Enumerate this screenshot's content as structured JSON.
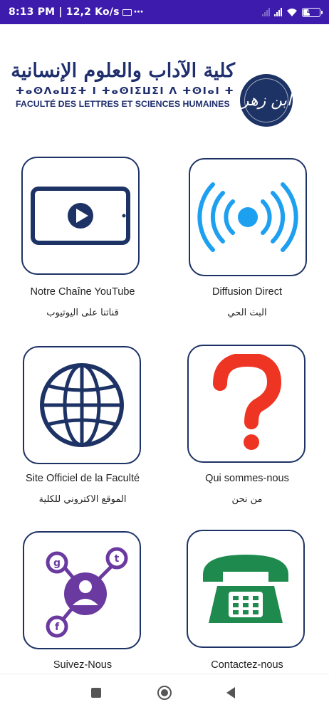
{
  "status_bar": {
    "time_net": "8:13 PM | 12,2 Ko/s",
    "extra": "⋯",
    "battery": "41",
    "battery_level": 0.41
  },
  "header": {
    "arabic_title": "كلية الآداب والعلوم الإنسانية",
    "tifinagh": "ⵜⴰⵙⴷⴰⵡⵉⵜ ⵏ ⵜⴰⵙⵏⵉⵡⵉⵏ ⴷ ⵜⵙⵏⴰⵏ ⵜⵉⴼⴷⵉⵏⵉⵏ",
    "faculty_fr": "FACULTÉ DES LETTRES ET SCIENCES HUMAINES",
    "logo_mark": "ابن زهر"
  },
  "tiles": [
    {
      "fr": "Notre Chaîne YouTube",
      "ar": "قناتنا على اليوتيوب",
      "icon": "youtube-tablet-icon"
    },
    {
      "fr": "Diffusion Direct",
      "ar": "البث الحي",
      "icon": "live-broadcast-icon"
    },
    {
      "fr": "Site Officiel de la Faculté",
      "ar": "الموقع الاكتروني للكلية",
      "icon": "globe-icon"
    },
    {
      "fr": "Qui sommes-nous",
      "ar": "من نحن",
      "icon": "question-mark-icon"
    },
    {
      "fr": "Suivez-Nous",
      "ar": "",
      "icon": "social-network-icon"
    },
    {
      "fr": "Contactez-nous",
      "ar": "",
      "icon": "telephone-icon"
    }
  ],
  "colors": {
    "status_bar": "#3d1cad",
    "brand_navy": "#1d3265",
    "live_blue": "#1ea0f0",
    "question_red": "#ee3524",
    "social_purple": "#6a3aa0",
    "phone_green": "#1e8a4e"
  }
}
